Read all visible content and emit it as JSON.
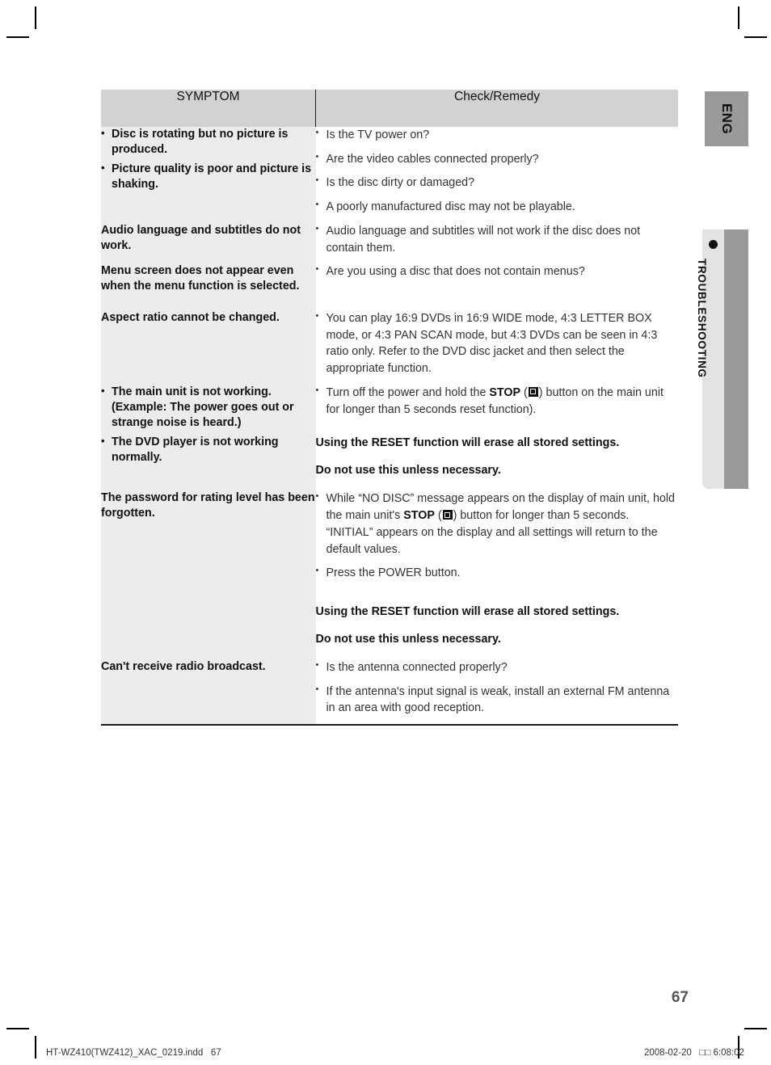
{
  "page": {
    "number": "67",
    "language_tab": "ENG",
    "section_tab": "TROUBLESHOOTING",
    "footer_left": "HT-WZ410(TWZ412)_XAC_0219.indd   67",
    "footer_right": "2008-02-20   □□ 6:08:02"
  },
  "table": {
    "headers": {
      "symptom": "SYMPTOM",
      "remedy": "Check/Remedy"
    },
    "rows": [
      {
        "symptom_items": [
          "Disc is rotating but no picture is produced.",
          "Picture quality is poor and picture is shaking."
        ],
        "remedy_items": [
          "Is the TV power on?",
          "Are the video cables connected properly?",
          "Is the disc dirty or damaged?",
          "A poorly manufactured disc may not be playable."
        ]
      },
      {
        "symptom_text": "Audio language and subtitles do not work.",
        "remedy_items": [
          "Audio language and subtitles will not work if the disc does not contain them."
        ]
      },
      {
        "symptom_text": "Menu screen does not appear even when the menu function is selected.",
        "remedy_items": [
          "Are you using a disc that does not contain menus?"
        ]
      },
      {
        "symptom_text": "Aspect ratio cannot be changed.",
        "remedy_items": [
          "You can play 16:9 DVDs in 16:9 WIDE mode, 4:3 LETTER BOX mode, or 4:3 PAN SCAN mode, but 4:3 DVDs can be seen in 4:3 ratio only. Refer to the DVD disc jacket and then select the appropriate function."
        ]
      },
      {
        "symptom_items": [
          "The main unit is not working. (Example: The power goes out or strange noise is heard.)",
          "The DVD player is not working normally."
        ],
        "remedy_prefix": "Turn off the power and hold the ",
        "remedy_bold": "STOP",
        "remedy_suffix": ") button on the main unit for longer than 5 seconds reset function).",
        "note_line1": "Using the RESET function will erase all stored settings.",
        "note_line2": "Do not use this unless necessary."
      },
      {
        "symptom_text": "The password for rating level has been forgotten.",
        "remedy_prefix": "While “NO DISC” message appears on the display of main unit, hold the main unit's ",
        "remedy_bold": "STOP",
        "remedy_suffix": ") button for longer than 5 seconds. “INITIAL” appears on the display and all settings will return to the default values.",
        "remedy_item2": "Press the POWER button.",
        "note_line1": "Using the RESET function will erase all stored settings.",
        "note_line2": "Do not use this unless necessary."
      },
      {
        "symptom_text": "Can't receive radio broadcast.",
        "remedy_items": [
          "Is the antenna connected properly?",
          "If the antenna's input signal is weak, install an external FM antenna in an area with good reception."
        ]
      }
    ]
  }
}
